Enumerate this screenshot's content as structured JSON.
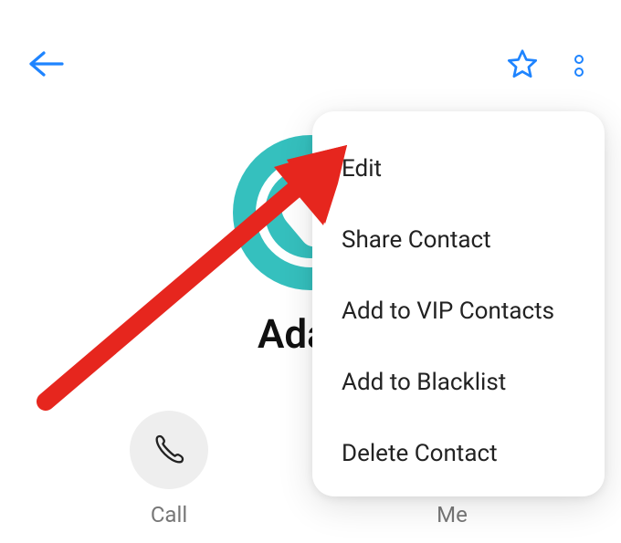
{
  "topbar": {
    "back_icon": "back-arrow",
    "favorite_icon": "star-outline",
    "more_icon": "more-dots"
  },
  "contact": {
    "name": "Adam",
    "avatar_color": "#35c0be"
  },
  "actions": {
    "call": {
      "label": "Call",
      "icon": "phone"
    },
    "message": {
      "label": "Me",
      "icon": "message"
    }
  },
  "dropdown": {
    "items": [
      {
        "label": "Edit"
      },
      {
        "label": "Share Contact"
      },
      {
        "label": "Add to VIP Contacts"
      },
      {
        "label": "Add to Blacklist"
      },
      {
        "label": "Delete Contact"
      }
    ]
  },
  "annotation": {
    "arrow_color": "#e6261e"
  }
}
